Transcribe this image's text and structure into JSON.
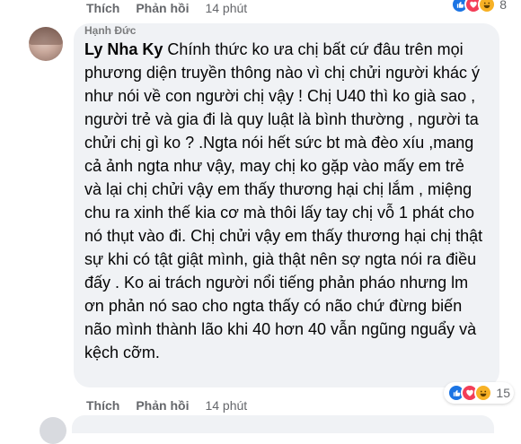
{
  "previous_comment": {
    "actions": {
      "like": "Thích",
      "reply": "Phản hồi",
      "time": "14 phút"
    },
    "reactions": [
      "like",
      "love",
      "haha"
    ],
    "reaction_count": "8"
  },
  "comment": {
    "author_partial": "Hạnh Đức",
    "mention": "Ly Nha Ky",
    "text": " Chính thức ko ưa chị bất cứ đâu trên mọi phương diện truyền thông nào vì chị chửi người khác ý như nói về con người chị vậy ! Chị U40 thì ko già sao , người trẻ và gia đi là quy luật là bình thường , người ta chửi chị gì ko ? .Ngta nói hết sức bt mà đèo xíu ,mang cả ảnh ngta như vậy, may chị ko gặp vào mấy em trẻ và lại chị chửi vậy em thấy thương hại chị lắm , miệng chu ra xinh thế kia cơ mà thôi lấy tay chị vỗ 1 phát cho nó thụt vào đi. Chị chửi vậy em thấy thương hại chị thật sự khi có tật giật mình, già thật nên sợ ngta nói ra điều đấy . Ko ai trách người nổi tiếng phản pháo nhưng lm ơn phản nó sao cho ngta thấy có não chứ đừng biến não mình thành lão khi 40 hơn 40 vẫn ngũng nguẩy và kệch cỡm.",
    "actions": {
      "like": "Thích",
      "reply": "Phản hồi",
      "time": "14 phút"
    },
    "reactions": [
      "like",
      "love",
      "haha"
    ],
    "reaction_count": "15"
  },
  "colors": {
    "bubble": "#f0f2f5",
    "secondary_text": "#65676b",
    "like_blue": "#1b74e4",
    "love_red": "#f33e58",
    "haha_yellow": "#f7b125"
  }
}
